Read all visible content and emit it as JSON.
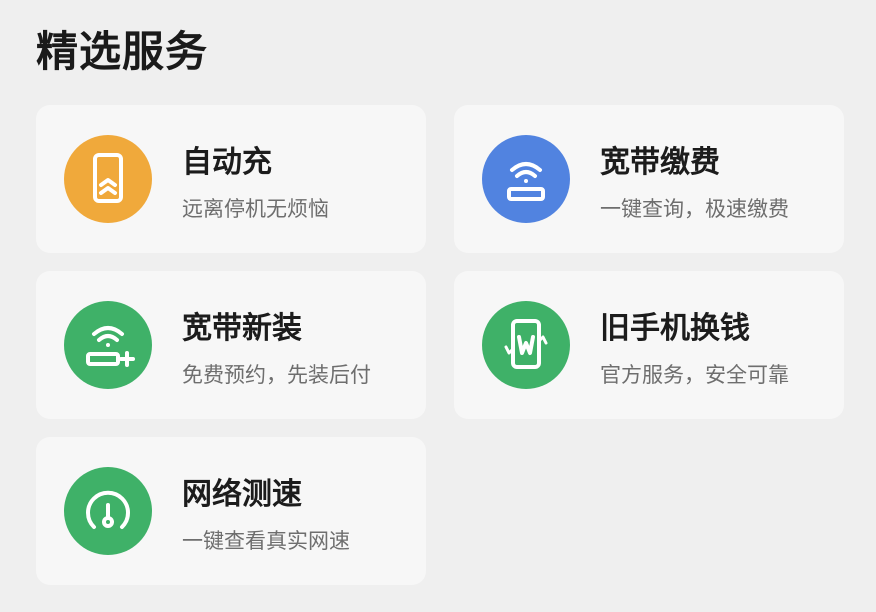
{
  "section": {
    "title": "精选服务"
  },
  "colors": {
    "orange": "#f0a93b",
    "blue": "#5183e0",
    "green": "#3fb168"
  },
  "services": [
    {
      "title": "自动充",
      "subtitle": "远离停机无烦恼",
      "icon": "phone-recharge-icon",
      "color": "orange"
    },
    {
      "title": "宽带缴费",
      "subtitle": "一键查询，极速缴费",
      "icon": "wifi-router-icon",
      "color": "blue"
    },
    {
      "title": "宽带新装",
      "subtitle": "免费预约，先装后付",
      "icon": "wifi-add-icon",
      "color": "green"
    },
    {
      "title": "旧手机换钱",
      "subtitle": "官方服务，安全可靠",
      "icon": "phone-trade-in-icon",
      "color": "green"
    },
    {
      "title": "网络测速",
      "subtitle": "一键查看真实网速",
      "icon": "speedometer-icon",
      "color": "green"
    }
  ]
}
